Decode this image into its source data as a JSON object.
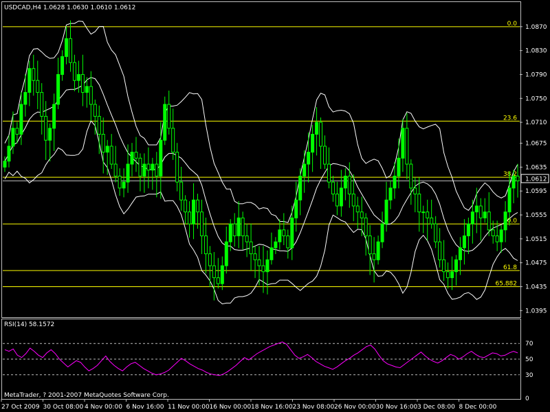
{
  "colors": {
    "background": "#000000",
    "panel_border": "#c0c0c0",
    "candle_up": "#00ff00",
    "candle_down": "#00ff00",
    "bollinger": "#ffffff",
    "fibonacci": "#ffff00",
    "rsi_line": "#ff00ff",
    "rsi_levels": "#c0c0c0",
    "text": "#ffffff"
  },
  "header": {
    "label": "USDCAD,H4  1.0628 1.0630 1.0610 1.0612"
  },
  "price_marker": "1.0612",
  "copyright": "MetaTrader, ? 2001-2007 MetaQuotes Software Corp.",
  "chart_data": [
    {
      "type": "candlestick",
      "symbol": "USDCAD",
      "timeframe": "H4",
      "last_ohlc": {
        "open": 1.0628,
        "high": 1.063,
        "low": 1.061,
        "close": 1.0612
      },
      "ylim": [
        1.0385,
        1.091
      ],
      "y_ticks": [
        "1.0870",
        "1.0830",
        "1.0790",
        "1.0750",
        "1.0710",
        "1.0675",
        "1.0635",
        "1.0595",
        "1.0555",
        "1.0515",
        "1.0475",
        "1.0435",
        "1.0395"
      ],
      "x_ticks": [
        "27 Oct 2009",
        "30 Oct 08:00",
        "4 Nov 00:00",
        "6 Nov 16:00",
        "11 Nov 00:00",
        "16 Nov 00:00",
        "18 Nov 16:00",
        "23 Nov 08:00",
        "26 Nov 00:00",
        "30 Nov 16:00",
        "3 Dec 08:00",
        "8 Dec 00:00"
      ],
      "fibonacci_levels": [
        {
          "label": "0.0",
          "price": 1.087
        },
        {
          "label": "23.6",
          "price": 1.0712
        },
        {
          "label": "38.2",
          "price": 1.0618
        },
        {
          "label": "50.0",
          "price": 1.054
        },
        {
          "label": "61.8",
          "price": 1.0462
        },
        {
          "label": "65.882",
          "price": 1.0435
        }
      ],
      "close_series": [
        1.0645,
        1.067,
        1.07,
        1.069,
        1.074,
        1.076,
        1.08,
        1.078,
        1.076,
        1.072,
        1.068,
        1.07,
        1.074,
        1.079,
        1.082,
        1.085,
        1.081,
        1.078,
        1.079,
        1.076,
        1.077,
        1.074,
        1.072,
        1.069,
        1.066,
        1.067,
        1.064,
        1.062,
        1.06,
        1.061,
        1.064,
        1.066,
        1.065,
        1.062,
        1.064,
        1.063,
        1.064,
        1.062,
        1.068,
        1.074,
        1.07,
        1.066,
        1.061,
        1.058,
        1.056,
        1.054,
        1.058,
        1.056,
        1.052,
        1.049,
        1.047,
        1.045,
        1.044,
        1.047,
        1.051,
        1.054,
        1.052,
        1.055,
        1.052,
        1.051,
        1.049,
        1.048,
        1.047,
        1.046,
        1.048,
        1.05,
        1.051,
        1.053,
        1.052,
        1.05,
        1.055,
        1.058,
        1.062,
        1.064,
        1.066,
        1.069,
        1.071,
        1.067,
        1.064,
        1.061,
        1.059,
        1.057,
        1.06,
        1.062,
        1.059,
        1.057,
        1.056,
        1.055,
        1.052,
        1.049,
        1.048,
        1.051,
        1.054,
        1.058,
        1.06,
        1.062,
        1.065,
        1.07,
        1.064,
        1.06,
        1.059,
        1.056,
        1.056,
        1.055,
        1.054,
        1.051,
        1.048,
        1.046,
        1.045,
        1.046,
        1.048,
        1.05,
        1.052,
        1.054,
        1.056,
        1.057,
        1.055,
        1.056,
        1.053,
        1.052,
        1.051,
        1.053,
        1.056,
        1.06,
        1.062,
        1.0612
      ]
    },
    {
      "type": "line",
      "title": "RSI(14) 58.1572",
      "ylim": [
        0,
        100
      ],
      "y_ticks": [
        "70",
        "50",
        "30",
        "0"
      ],
      "levels": [
        70,
        50,
        30
      ],
      "values": [
        62,
        60,
        63,
        55,
        52,
        57,
        64,
        60,
        55,
        52,
        58,
        62,
        57,
        50,
        45,
        40,
        44,
        48,
        46,
        40,
        35,
        38,
        42,
        48,
        54,
        47,
        42,
        38,
        35,
        40,
        44,
        46,
        42,
        38,
        35,
        32,
        30,
        31,
        33,
        36,
        41,
        46,
        51,
        48,
        44,
        41,
        38,
        36,
        33,
        31,
        30,
        29,
        31,
        34,
        38,
        42,
        47,
        52,
        49,
        53,
        57,
        60,
        63,
        66,
        68,
        70,
        72,
        69,
        62,
        55,
        51,
        53,
        56,
        52,
        47,
        44,
        41,
        39,
        37,
        40,
        44,
        48,
        51,
        55,
        58,
        62,
        66,
        68,
        63,
        55,
        48,
        44,
        42,
        40,
        39,
        43,
        47,
        51,
        55,
        59,
        54,
        50,
        47,
        45,
        48,
        52,
        56,
        54,
        50,
        53,
        57,
        60,
        56,
        53,
        52,
        55,
        58,
        57,
        54,
        55,
        58,
        60,
        58
      ]
    }
  ]
}
